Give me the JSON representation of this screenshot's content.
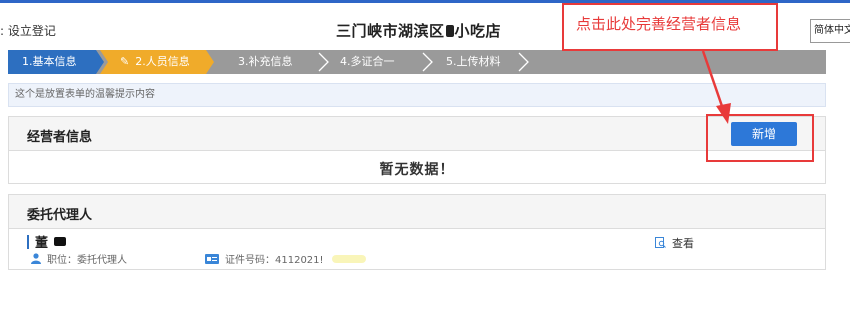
{
  "header": {
    "breadcrumb": ": 设立登记",
    "store_title_part1": "三门峡市湖滨区",
    "store_title_part2": "小吃店",
    "language": "简体中文",
    "brand_color": "#2e66c7"
  },
  "callout": {
    "text": "点击此处完善经营者信息",
    "color": "#e83a3a"
  },
  "steps": [
    {
      "label": "1.基本信息",
      "state": "done",
      "color": "#2d6fc0"
    },
    {
      "label": "2.人员信息",
      "state": "active",
      "color": "#f0ab2a"
    },
    {
      "label": "3.补充信息",
      "state": "pending"
    },
    {
      "label": "4.多证合一",
      "state": "pending"
    },
    {
      "label": "5.上传材料",
      "state": "pending"
    }
  ],
  "tip": {
    "text": "这个是放置表单的温馨提示内容"
  },
  "operator_panel": {
    "title": "经营者信息",
    "add_button": "新增",
    "empty_text": "暂无数据！"
  },
  "agent_panel": {
    "title": "委托代理人",
    "agent": {
      "name": "董",
      "position": "职位：委托代理人",
      "id_label": "证件号码：4112021!",
      "view_link": "查看"
    }
  }
}
